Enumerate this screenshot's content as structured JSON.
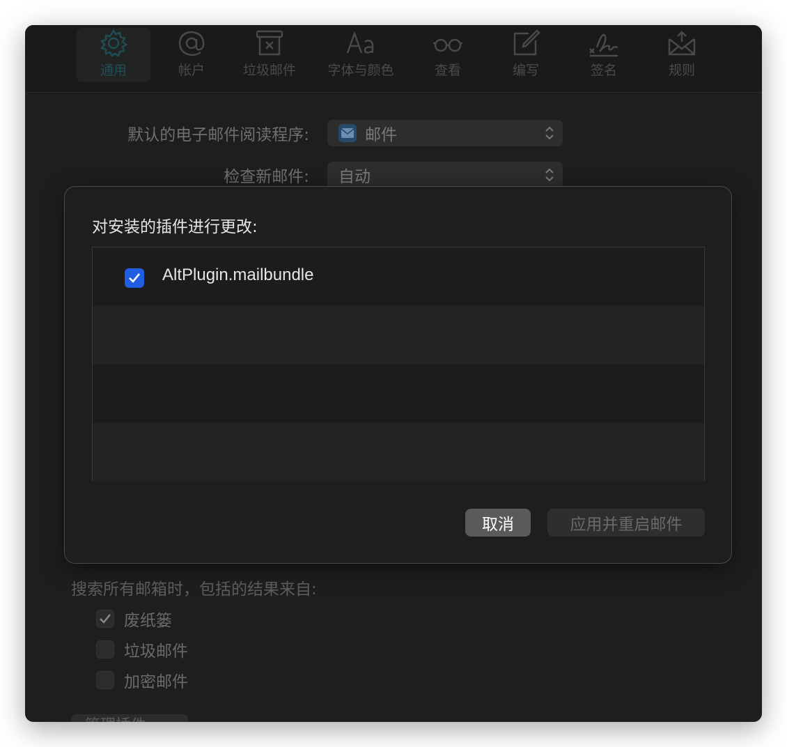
{
  "toolbar": {
    "tabs": [
      {
        "label": "通用",
        "icon": "gear-icon",
        "active": true
      },
      {
        "label": "帐户",
        "icon": "at-icon",
        "active": false
      },
      {
        "label": "垃圾邮件",
        "icon": "junk-tray-icon",
        "active": false
      },
      {
        "label": "字体与颜色",
        "icon": "font-icon",
        "active": false
      },
      {
        "label": "查看",
        "icon": "glasses-icon",
        "active": false
      },
      {
        "label": "编写",
        "icon": "compose-icon",
        "active": false
      },
      {
        "label": "签名",
        "icon": "signature-icon",
        "active": false
      },
      {
        "label": "规则",
        "icon": "rules-envelope-icon",
        "active": false
      }
    ]
  },
  "general": {
    "default_reader_label": "默认的电子邮件阅读程序:",
    "default_reader_value": "邮件",
    "check_mail_label": "检查新邮件:",
    "check_mail_value": "自动"
  },
  "search": {
    "title": "搜索所有邮箱时，包括的结果来自:",
    "options": [
      {
        "label": "废纸篓",
        "checked": true
      },
      {
        "label": "垃圾邮件",
        "checked": false
      },
      {
        "label": "加密邮件",
        "checked": false
      }
    ],
    "manage_plugins_label": "管理插件…"
  },
  "sheet": {
    "title": "对安装的插件进行更改:",
    "plugins": [
      {
        "name": "AltPlugin.mailbundle",
        "checked": true
      }
    ],
    "cancel_label": "取消",
    "apply_label": "应用并重启邮件"
  },
  "colors": {
    "accent": "#1f5ee0",
    "window_bg": "#1e1e1e"
  }
}
